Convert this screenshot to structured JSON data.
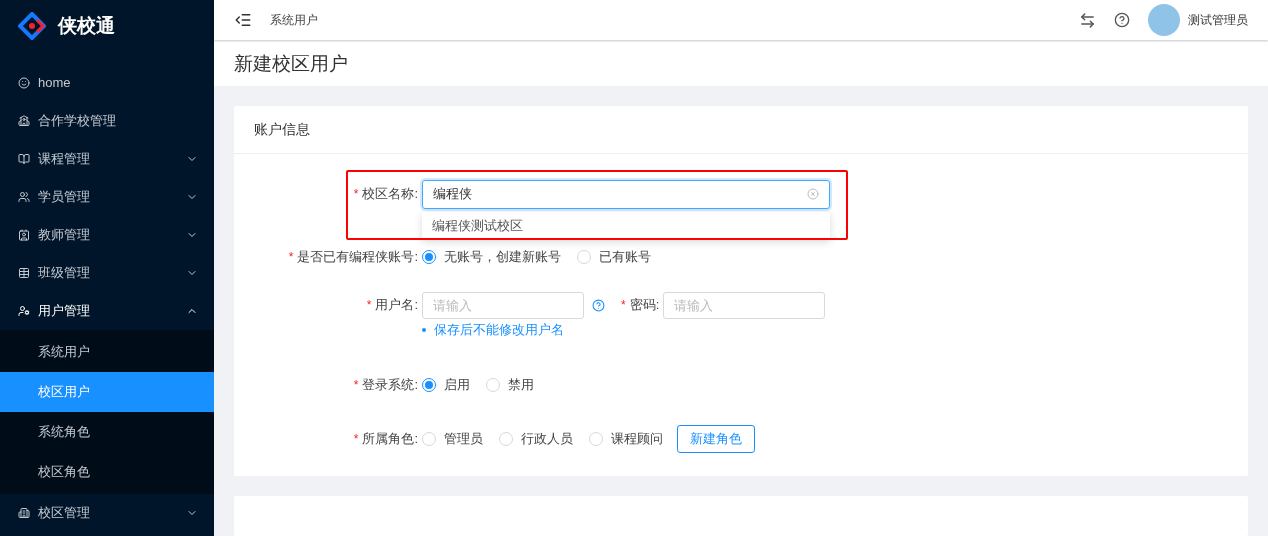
{
  "sidebar": {
    "logo": "侠校通",
    "items": [
      {
        "label": "home",
        "has_children": false,
        "expanded": false
      },
      {
        "label": "合作学校管理",
        "has_children": false,
        "expanded": false
      },
      {
        "label": "课程管理",
        "has_children": true,
        "expanded": false
      },
      {
        "label": "学员管理",
        "has_children": true,
        "expanded": false
      },
      {
        "label": "教师管理",
        "has_children": true,
        "expanded": false
      },
      {
        "label": "班级管理",
        "has_children": true,
        "expanded": false
      },
      {
        "label": "用户管理",
        "has_children": true,
        "expanded": true,
        "children": [
          {
            "label": "系统用户",
            "selected": false
          },
          {
            "label": "校区用户",
            "selected": true
          },
          {
            "label": "系统角色",
            "selected": false
          },
          {
            "label": "校区角色",
            "selected": false
          }
        ]
      },
      {
        "label": "校区管理",
        "has_children": true,
        "expanded": false
      }
    ]
  },
  "header": {
    "breadcrumb": "系统用户",
    "user": "测试管理员"
  },
  "page_title": "新建校区用户",
  "card": {
    "title": "账户信息",
    "campus_name": {
      "label": "校区名称:",
      "required_mark": "*",
      "value": "编程侠",
      "suggestion": "编程侠测试校区"
    },
    "has_account": {
      "label": "是否已有编程侠账号:",
      "required_mark": "*",
      "options": [
        {
          "label": "无账号，创建新账号",
          "selected": true
        },
        {
          "label": "已有账号",
          "selected": false
        }
      ]
    },
    "username": {
      "label": "用户名:",
      "required_mark": "*",
      "placeholder": "请输入",
      "hint": "保存后不能修改用户名"
    },
    "password": {
      "label": "密码:",
      "required_mark": "*",
      "placeholder": "请输入"
    },
    "login": {
      "label": "登录系统:",
      "required_mark": "*",
      "options": [
        {
          "label": "启用",
          "selected": true
        },
        {
          "label": "禁用",
          "selected": false
        }
      ]
    },
    "role": {
      "label": "所属角色:",
      "required_mark": "*",
      "options": [
        {
          "label": "管理员",
          "selected": false
        },
        {
          "label": "行政人员",
          "selected": false
        },
        {
          "label": "课程顾问",
          "selected": false
        }
      ],
      "button": "新建角色"
    }
  }
}
